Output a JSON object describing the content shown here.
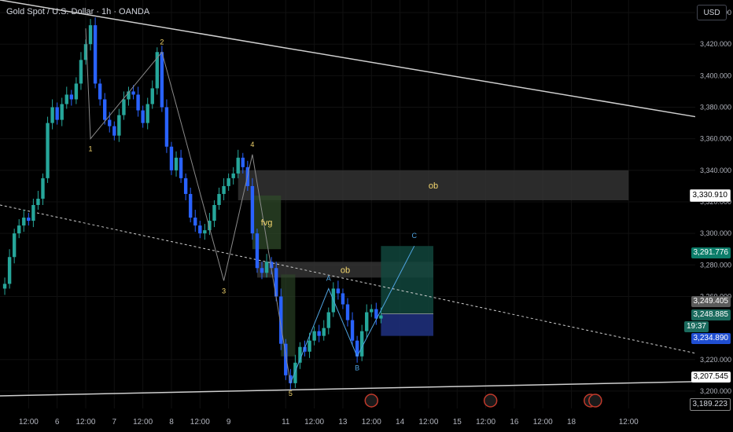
{
  "header": {
    "title": "Gold Spot / U.S. Dollar · 1h · OANDA",
    "currency_button": "USD"
  },
  "colors": {
    "background": "#000000",
    "bull": "#26a69a",
    "bear": "#2962ff",
    "wave_label": "#f5d76e",
    "abc_label": "#4fa3e0",
    "ob_zone": "#3a3a3a",
    "fvg_zone": "#2f4a2a",
    "target_zone": "#124a40",
    "stop_zone": "#1e2f7a",
    "trendline": "#cfcfcf"
  },
  "price_tags": {
    "ob_level": "3,330.910",
    "target": "3,291.776",
    "last": "3,249.405",
    "current": "3,248.885",
    "countdown": "19:37",
    "stop": "3,234.890",
    "low_line": "3,207.545",
    "bottom": "3,189.223"
  },
  "chart_data": {
    "type": "candlestick",
    "title": "Gold Spot / U.S. Dollar · 1h · OANDA",
    "ylim": [
      3189,
      3448
    ],
    "y_ticks": [
      "3,440.000",
      "3,420.000",
      "3,400.000",
      "3,380.000",
      "3,360.000",
      "3,340.000",
      "3,320.000",
      "3,300.000",
      "3,280.000",
      "3,260.000",
      "3,220.000",
      "3,200.000"
    ],
    "y_tick_values": [
      3440,
      3420,
      3400,
      3380,
      3360,
      3340,
      3320,
      3300,
      3280,
      3260,
      3220,
      3200
    ],
    "x_range": [
      -72,
      220
    ],
    "x_ticks": [
      "12:00",
      "6",
      "12:00",
      "7",
      "12:00",
      "8",
      "12:00",
      "9",
      "11",
      "12:00",
      "13",
      "12:00",
      "14",
      "12:00",
      "15",
      "12:00",
      "16",
      "12:00",
      "18",
      "12:00"
    ],
    "x_tick_values": [
      -60,
      -48,
      -36,
      -24,
      -12,
      0,
      12,
      24,
      48,
      60,
      72,
      84,
      96,
      108,
      120,
      132,
      144,
      156,
      168,
      192
    ],
    "price_path": [
      [
        -72,
        3265
      ],
      [
        -70,
        3268
      ],
      [
        -68,
        3285
      ],
      [
        -66,
        3300
      ],
      [
        -64,
        3305
      ],
      [
        -62,
        3310
      ],
      [
        -60,
        3308
      ],
      [
        -58,
        3318
      ],
      [
        -56,
        3322
      ],
      [
        -54,
        3335
      ],
      [
        -52,
        3370
      ],
      [
        -50,
        3380
      ],
      [
        -48,
        3372
      ],
      [
        -46,
        3382
      ],
      [
        -44,
        3388
      ],
      [
        -42,
        3385
      ],
      [
        -40,
        3395
      ],
      [
        -38,
        3410
      ],
      [
        -36,
        3420
      ],
      [
        -34,
        3432
      ],
      [
        -32,
        3395
      ],
      [
        -30,
        3385
      ],
      [
        -28,
        3372
      ],
      [
        -26,
        3368
      ],
      [
        -24,
        3362
      ],
      [
        -22,
        3375
      ],
      [
        -20,
        3385
      ],
      [
        -18,
        3390
      ],
      [
        -16,
        3388
      ],
      [
        -14,
        3378
      ],
      [
        -12,
        3370
      ],
      [
        -10,
        3382
      ],
      [
        -8,
        3392
      ],
      [
        -6,
        3415
      ],
      [
        -4,
        3380
      ],
      [
        -2,
        3355
      ],
      [
        0,
        3340
      ],
      [
        2,
        3348
      ],
      [
        4,
        3335
      ],
      [
        6,
        3325
      ],
      [
        8,
        3310
      ],
      [
        10,
        3305
      ],
      [
        12,
        3300
      ],
      [
        14,
        3302
      ],
      [
        16,
        3308
      ],
      [
        18,
        3318
      ],
      [
        20,
        3325
      ],
      [
        22,
        3330
      ],
      [
        24,
        3335
      ],
      [
        26,
        3338
      ],
      [
        28,
        3348
      ],
      [
        30,
        3342
      ],
      [
        32,
        3330
      ],
      [
        34,
        3300
      ],
      [
        36,
        3278
      ],
      [
        38,
        3275
      ],
      [
        40,
        3282
      ],
      [
        42,
        3278
      ],
      [
        44,
        3260
      ],
      [
        46,
        3230
      ],
      [
        48,
        3210
      ],
      [
        50,
        3205
      ],
      [
        52,
        3218
      ],
      [
        54,
        3228
      ],
      [
        56,
        3225
      ],
      [
        58,
        3232
      ],
      [
        60,
        3238
      ],
      [
        62,
        3235
      ],
      [
        64,
        3240
      ],
      [
        66,
        3250
      ],
      [
        68,
        3265
      ],
      [
        70,
        3262
      ],
      [
        72,
        3255
      ],
      [
        74,
        3245
      ],
      [
        76,
        3232
      ],
      [
        78,
        3222
      ],
      [
        80,
        3238
      ],
      [
        82,
        3250
      ],
      [
        84,
        3252
      ],
      [
        86,
        3246
      ],
      [
        88,
        3248
      ]
    ],
    "waves": {
      "impulse": [
        [
          -34,
          3360,
          "1"
        ],
        [
          -4,
          3415,
          "2"
        ],
        [
          22,
          3270,
          "3"
        ],
        [
          34,
          3350,
          "4"
        ],
        [
          50,
          3205,
          "5"
        ]
      ],
      "correction": [
        [
          66,
          3265,
          "A"
        ],
        [
          78,
          3222,
          "B"
        ],
        [
          102,
          3292,
          "C"
        ]
      ]
    },
    "zones": [
      {
        "label": "ob",
        "x0": 28,
        "x1": 192,
        "y0": 3321,
        "y1": 3340
      },
      {
        "label": "fvg",
        "x0": 34,
        "x1": 46,
        "y0": 3290,
        "y1": 3324
      },
      {
        "label": "ob",
        "x0": 36,
        "x1": 110,
        "y0": 3272,
        "y1": 3282
      }
    ],
    "position": {
      "entry": 3249,
      "target": 3292,
      "stop": 3235,
      "x0": 88,
      "x1": 110
    },
    "trendlines": [
      {
        "x0": -72,
        "y0": 3448,
        "x1": 220,
        "y1": 3374,
        "style": "solid"
      },
      {
        "x0": -72,
        "y0": 3318,
        "x1": 220,
        "y1": 3224,
        "style": "dashed"
      },
      {
        "x0": -72,
        "y0": 3197,
        "x1": 220,
        "y1": 3206,
        "style": "solid"
      }
    ],
    "annotations": [
      "1",
      "2",
      "3",
      "4",
      "5",
      "A",
      "B",
      "C",
      "ob",
      "fvg",
      "ob"
    ]
  }
}
